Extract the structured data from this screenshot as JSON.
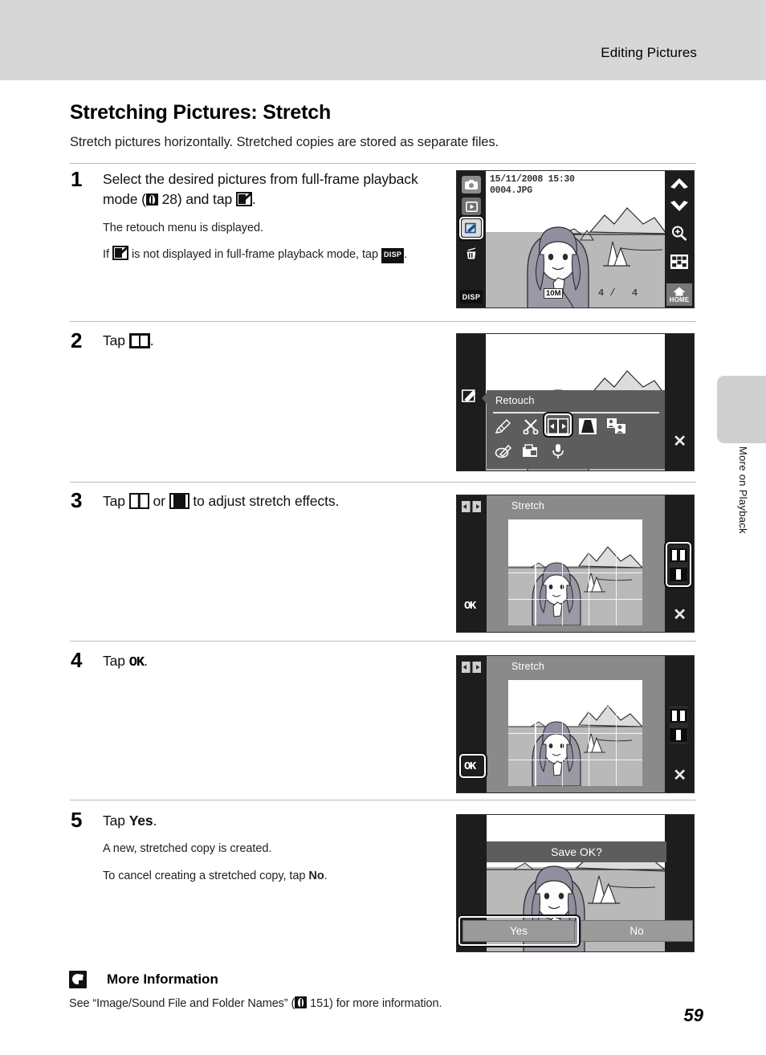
{
  "header": {
    "title": "Editing Pictures"
  },
  "side_tab": {
    "label": "More on Playback"
  },
  "section": {
    "title": "Stretching Pictures: Stretch",
    "intro": "Stretch pictures horizontally. Stretched copies are stored as separate files."
  },
  "steps": [
    {
      "number": "1",
      "lead_part1": "Select the desired pictures from full-frame playback mode (",
      "lead_ref": "28",
      "lead_part2": ") and tap",
      "lead_part3": ".",
      "notes": [
        {
          "prefix": "The retouch menu is displayed.",
          "suffix": ""
        },
        {
          "prefix": "If",
          "middle": "is not displayed in full-frame playback mode, tap",
          "suffix": "."
        }
      ]
    },
    {
      "number": "2",
      "lead_part1": "Tap",
      "lead_part3": "."
    },
    {
      "number": "3",
      "lead_part1": "Tap",
      "lead_mid": "or",
      "lead_part3": "to adjust stretch effects."
    },
    {
      "number": "4",
      "lead_part1": "Tap",
      "ok_label": "OK",
      "lead_part3": "."
    },
    {
      "number": "5",
      "lead_part1": "Tap",
      "bold_word": "Yes",
      "lead_part3": ".",
      "notes": [
        "A new, stretched copy is created.",
        "To cancel creating a stretched copy, tap No."
      ],
      "note2_prefix": "To cancel creating a stretched copy, tap",
      "note2_bold": "No",
      "note2_suffix": "."
    }
  ],
  "screens": {
    "playback": {
      "datetime": "15/11/2008  15:30",
      "filename": "0004.JPG",
      "image_size_badge": "10M",
      "frame_current": "4 /",
      "frame_total": "4",
      "disp_label": "DISP",
      "home_label": "HOME",
      "left_icons": [
        "camera-icon",
        "playback-icon",
        "retouch-icon",
        "delete-icon"
      ],
      "right_icons": [
        "chevron-up-icon",
        "chevron-down-icon",
        "zoom-in-icon",
        "thumbnail-grid-icon",
        "home-icon"
      ]
    },
    "retouch_menu": {
      "title": "Retouch",
      "icons_row1": [
        "quick-retouch-icon",
        "crop-scissors-icon",
        "stretch-icon",
        "perspective-control-icon",
        "skin-softening-icon"
      ],
      "icons_row2": [
        "d-lighting-icon",
        "small-picture-icon",
        "voice-memo-icon"
      ],
      "selected_icon": "stretch-icon",
      "close_label": "✕"
    },
    "stretch_adjust": {
      "title": "Stretch",
      "ok_label": "OK",
      "close_label": "✕",
      "wide_control": "stretch-wide-icon",
      "narrow_control": "stretch-narrow-icon",
      "highlight": "stretch-controls"
    },
    "stretch_confirm": {
      "title": "Stretch",
      "ok_label": "OK",
      "close_label": "✕",
      "highlight": "ok-button"
    },
    "save_dialog": {
      "prompt": "Save OK?",
      "yes_label": "Yes",
      "no_label": "No",
      "highlight": "yes-button"
    }
  },
  "more_information": {
    "title": "More Information",
    "text_part1": "See “Image/Sound File and Folder Names” (",
    "ref": "151",
    "text_part2": ") for more information."
  },
  "page_number": "59",
  "colors": {
    "header_band": "#d7d7d7",
    "tab": "#cfcfcf",
    "rule": "#b9b9b9",
    "lcd_frame": "#1a1a1a",
    "panel": "#5d5d5d"
  }
}
